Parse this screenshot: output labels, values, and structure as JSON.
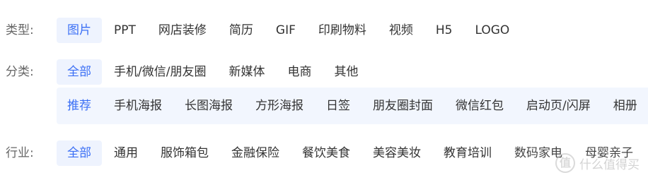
{
  "type_row": {
    "label": "类型:",
    "items": [
      "图片",
      "PPT",
      "网店装修",
      "简历",
      "GIF",
      "印刷物料",
      "视频",
      "H5",
      "LOGO"
    ]
  },
  "category_row": {
    "label": "分类:",
    "items": [
      "全部",
      "手机/微信/朋友圈",
      "新媒体",
      "电商",
      "其他"
    ],
    "sub_items": [
      "推荐",
      "手机海报",
      "长图海报",
      "方形海报",
      "日签",
      "朋友圈封面",
      "微信红包",
      "启动页/闪屏",
      "相册"
    ]
  },
  "industry_row": {
    "label": "行业:",
    "items": [
      "全部",
      "通用",
      "服饰箱包",
      "金融保险",
      "餐饮美食",
      "美容美妆",
      "教育培训",
      "数码家电",
      "母婴亲子"
    ]
  },
  "watermark": {
    "logo_glyph": "值",
    "text": "什么值得买"
  },
  "colors": {
    "accent": "#3b6ff5",
    "active_bg": "#eef3fe",
    "subpanel_bg": "#f2f6fe"
  }
}
